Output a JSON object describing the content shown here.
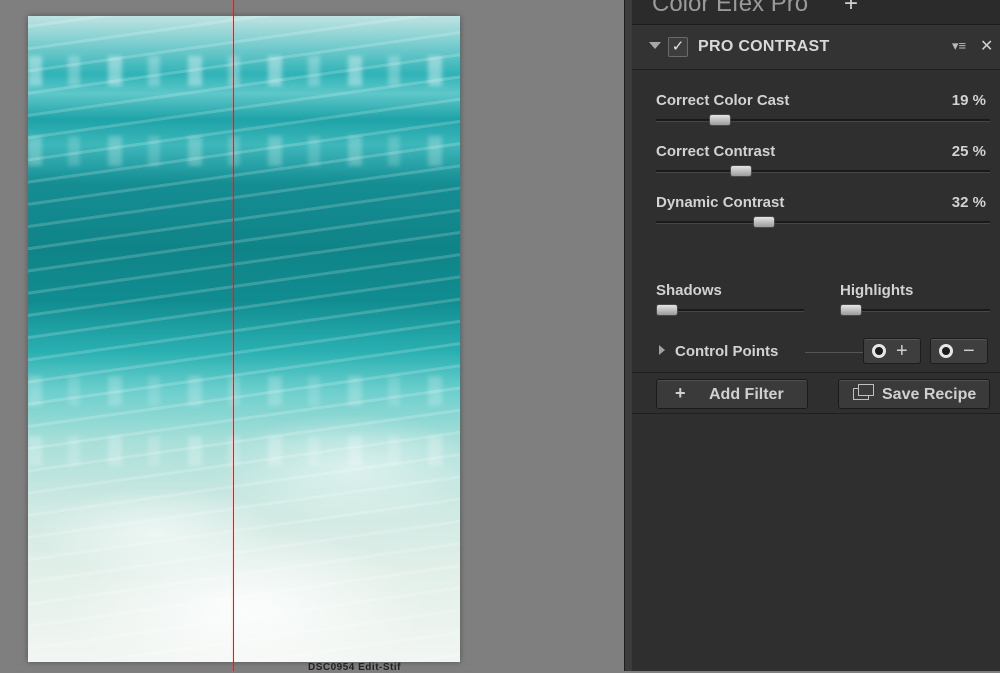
{
  "preview": {
    "filename": "DSC0954  Edit-Stif"
  },
  "panel": {
    "app_title": "Color Efex Pro",
    "add_icon_symbol": "+",
    "filter": {
      "name": "PRO CONTRAST",
      "enabled_symbol": "✓",
      "menu_symbol": "▾≡",
      "close_symbol": "✕"
    },
    "sliders": [
      {
        "label": "Correct Color Cast",
        "value": "19 %",
        "level": 0.19
      },
      {
        "label": "Correct Contrast",
        "value": "25 %",
        "level": 0.25
      },
      {
        "label": "Dynamic Contrast",
        "value": "32 %",
        "level": 0.32
      }
    ],
    "tone_sliders": [
      {
        "label": "Shadows",
        "level": 0.0
      },
      {
        "label": "Highlights",
        "level": 0.0
      }
    ],
    "control_points": {
      "label": "Control Points",
      "add_symbol": "+",
      "remove_symbol": "−"
    },
    "buttons": {
      "add_filter": "Add Filter",
      "add_filter_symbol": "+",
      "save_recipe": "Save Recipe"
    }
  },
  "colors": {
    "split_line": "#e01e1e",
    "panel_bg": "#2f2f2f"
  },
  "icons": [
    "chevron-down-icon",
    "checkbox-icon",
    "menu-icon",
    "close-icon",
    "chevron-right-icon",
    "control-point-icon",
    "plus-icon",
    "minus-icon",
    "recipe-icon"
  ]
}
